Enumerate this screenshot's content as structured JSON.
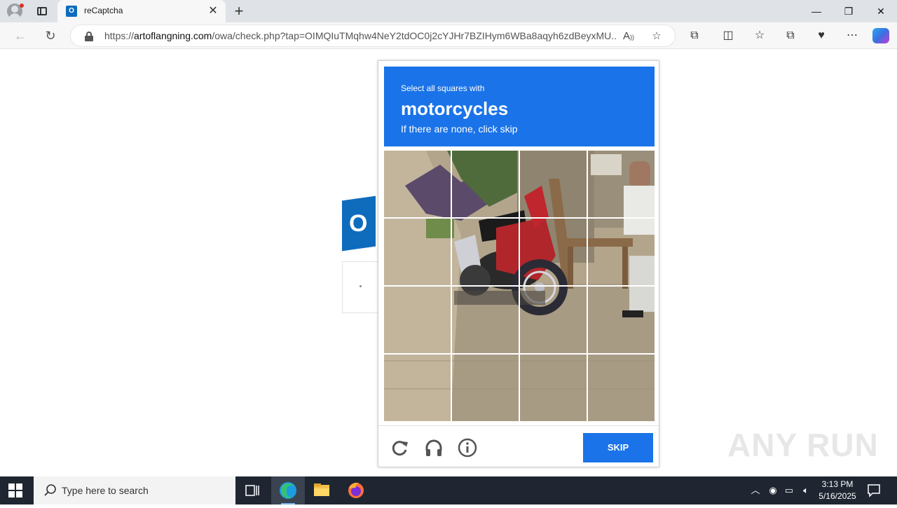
{
  "browser": {
    "tab_title": "reCaptcha",
    "tab_icon_letter": "O",
    "url_prefix": "https://",
    "url_domain": "artoflangning.com",
    "url_path": "/owa/check.php?tap=OIMQIuTMqhw4NeY2tdOC0j2cYJHr7BZIHym6WBa8aqyh6zdBeyxMU...",
    "window_controls": {
      "minimize": "—",
      "restore": "❐",
      "close": "✕"
    }
  },
  "outlook": {
    "logo_letter": "O"
  },
  "captcha": {
    "instruction": "Select all squares with",
    "target": "motorcycles",
    "hint": "If there are none, click skip",
    "grid_size": 4,
    "skip_label": "SKIP",
    "footer_icons": [
      "reload-icon",
      "audio-headphones-icon",
      "info-icon"
    ]
  },
  "watermark": "ANY RUN",
  "taskbar": {
    "search_placeholder": "Type here to search",
    "time": "3:13 PM",
    "date": "5/16/2025"
  },
  "colors": {
    "captcha_blue": "#1a73e8",
    "taskbar_bg": "#1f2632",
    "outlook_blue": "#0f6cbd"
  }
}
